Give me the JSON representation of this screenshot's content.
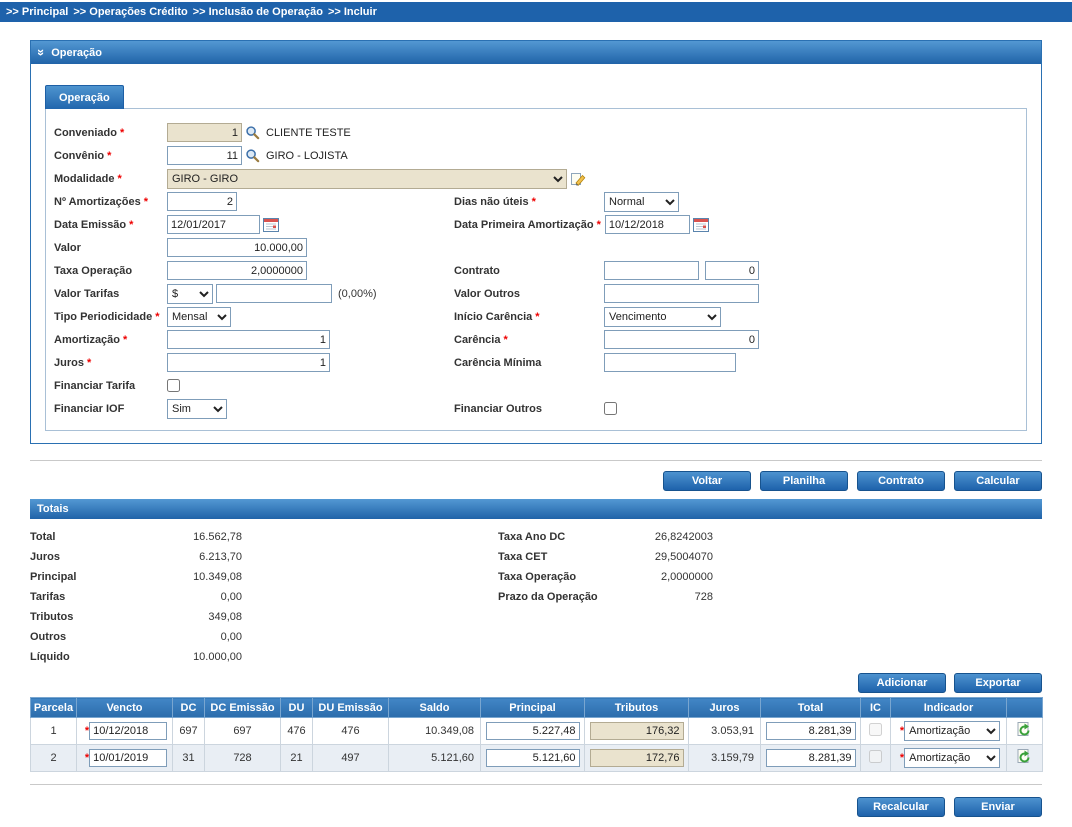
{
  "breadcrumb": {
    "items": [
      ">> Principal",
      ">> Operações Crédito",
      ">> Inclusão de Operação",
      ">> Incluir"
    ]
  },
  "panel": {
    "title": "Operação",
    "tab_label": "Operação"
  },
  "required_marker": "*",
  "icons": {
    "collapse": "»",
    "search": "magnifier",
    "calendar": "calendar-grid",
    "edit": "pencil-note",
    "row_action": "green-circular-arrow"
  },
  "colors": {
    "primary_blue": "#2166ad",
    "header_gradient_top": "#5398d3",
    "breadcrumb_bar": "#1e62ab",
    "readonly_field": "#eae3ce",
    "required_red": "#ee0000",
    "alt_row": "#e9eef4"
  },
  "form": {
    "conveniado": {
      "label": "Conveniado",
      "value": "1",
      "description": "CLIENTE TESTE"
    },
    "convenio": {
      "label": "Convênio",
      "value": "11",
      "description": "GIRO - LOJISTA"
    },
    "modalidade": {
      "label": "Modalidade",
      "value": "GIRO - GIRO"
    },
    "num_amortizacoes": {
      "label": "Nº Amortizações",
      "value": "2"
    },
    "dias_nao_uteis": {
      "label": "Dias não úteis",
      "value": "Normal"
    },
    "data_emissao": {
      "label": "Data Emissão",
      "value": "12/01/2017"
    },
    "data_primeira_amortizacao": {
      "label": "Data Primeira Amortização",
      "value": "10/12/2018"
    },
    "valor": {
      "label": "Valor",
      "value": "10.000,00"
    },
    "taxa_operacao": {
      "label": "Taxa Operação",
      "value": "2,0000000"
    },
    "contrato": {
      "label": "Contrato",
      "value_1": "",
      "value_2": "0"
    },
    "valor_tarifas": {
      "label": "Valor Tarifas",
      "currency": "$",
      "value": "",
      "suffix": "(0,00%)"
    },
    "valor_outros": {
      "label": "Valor Outros",
      "value": ""
    },
    "tipo_periodicidade": {
      "label": "Tipo Periodicidade",
      "value": "Mensal"
    },
    "inicio_carencia": {
      "label": "Início Carência",
      "value": "Vencimento"
    },
    "amortizacao": {
      "label": "Amortização",
      "value": "1"
    },
    "carencia": {
      "label": "Carência",
      "value": "0"
    },
    "juros": {
      "label": "Juros",
      "value": "1"
    },
    "carencia_minima": {
      "label": "Carência Mínima",
      "value": ""
    },
    "financiar_tarifa": {
      "label": "Financiar Tarifa"
    },
    "financiar_iof": {
      "label": "Financiar IOF",
      "value": "Sim"
    },
    "financiar_outros": {
      "label": "Financiar Outros"
    }
  },
  "actions": {
    "voltar": "Voltar",
    "planilha": "Planilha",
    "contrato": "Contrato",
    "calcular": "Calcular",
    "adicionar": "Adicionar",
    "exportar": "Exportar",
    "recalcular": "Recalcular",
    "enviar": "Enviar"
  },
  "totals": {
    "title": "Totais",
    "left": [
      {
        "label": "Total",
        "value": "16.562,78"
      },
      {
        "label": "Juros",
        "value": "6.213,70"
      },
      {
        "label": "Principal",
        "value": "10.349,08"
      },
      {
        "label": "Tarifas",
        "value": "0,00"
      },
      {
        "label": "Tributos",
        "value": "349,08"
      },
      {
        "label": "Outros",
        "value": "0,00"
      },
      {
        "label": "Líquido",
        "value": "10.000,00"
      }
    ],
    "right": [
      {
        "label": "Taxa Ano DC",
        "value": "26,8242003"
      },
      {
        "label": "Taxa CET",
        "value": "29,5004070"
      },
      {
        "label": "Taxa Operação",
        "value": "2,0000000"
      },
      {
        "label": "Prazo da Operação",
        "value": "728"
      }
    ]
  },
  "table": {
    "headers": [
      "Parcela",
      "Vencto",
      "DC",
      "DC Emissão",
      "DU",
      "DU Emissão",
      "Saldo",
      "Principal",
      "Tributos",
      "Juros",
      "Total",
      "IC",
      "Indicador"
    ],
    "rows": [
      {
        "parcela": "1",
        "vencto": "10/12/2018",
        "dc": "697",
        "dc_emissao": "697",
        "du": "476",
        "du_emissao": "476",
        "saldo": "10.349,08",
        "principal": "5.227,48",
        "tributos": "176,32",
        "juros": "3.053,91",
        "total": "8.281,39",
        "indicador": "Amortização"
      },
      {
        "parcela": "2",
        "vencto": "10/01/2019",
        "dc": "31",
        "dc_emissao": "728",
        "du": "21",
        "du_emissao": "497",
        "saldo": "5.121,60",
        "principal": "5.121,60",
        "tributos": "172,76",
        "juros": "3.159,79",
        "total": "8.281,39",
        "indicador": "Amortização"
      }
    ]
  }
}
